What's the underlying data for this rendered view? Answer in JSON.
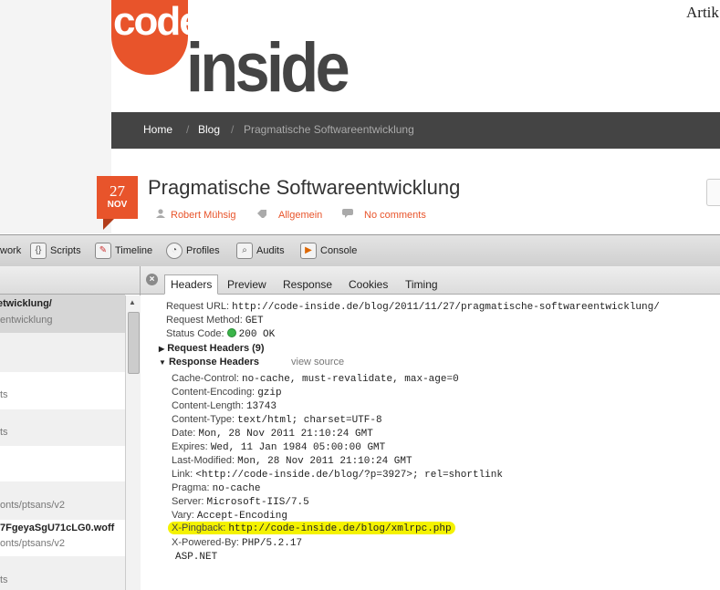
{
  "site": {
    "logo_code": "code",
    "logo_inside": "inside",
    "top_right_text": "Artik",
    "breadcrumb": [
      "Home",
      "Blog",
      "Pragmatische Softwareentwicklung"
    ],
    "date_day": "27",
    "date_month": "NOV",
    "post_title": "Pragmatische Softwareentwicklung",
    "author": "Robert Mühsig",
    "category": "Allgemein",
    "comments": "No comments",
    "accent_color": "#e8542b"
  },
  "devtools": {
    "toolbar": [
      {
        "label": "work",
        "icon": "network-icon"
      },
      {
        "label": "Scripts",
        "icon": "scripts-icon"
      },
      {
        "label": "Timeline",
        "icon": "timeline-icon"
      },
      {
        "label": "Profiles",
        "icon": "profiles-icon"
      },
      {
        "label": "Audits",
        "icon": "audits-icon"
      },
      {
        "label": "Console",
        "icon": "console-icon"
      }
    ],
    "resources": [
      {
        "name": "waretwicklung/",
        "path": "entwicklung"
      },
      {
        "name": "",
        "path": ""
      },
      {
        "name": "",
        "path": "ts"
      },
      {
        "name": "",
        "path": "ts"
      },
      {
        "name": "",
        "path": ""
      },
      {
        "name": "",
        "path": "onts/ptsans/v2"
      },
      {
        "name": "7FgeyaSgU71cLG0.woff",
        "path": "onts/ptsans/v2"
      },
      {
        "name": "",
        "path": "ts"
      }
    ],
    "tabs": [
      "Headers",
      "Preview",
      "Response",
      "Cookies",
      "Timing"
    ],
    "request": {
      "url_label": "Request URL:",
      "url": "http://code-inside.de/blog/2011/11/27/pragmatische-softwareentwicklung/",
      "method_label": "Request Method:",
      "method": "GET",
      "status_label": "Status Code:",
      "status": "200 OK"
    },
    "request_headers_label": "Request Headers (9)",
    "response_headers_label": "Response Headers",
    "view_source": "view source",
    "response_headers": [
      {
        "key": "Cache-Control:",
        "value": "no-cache, must-revalidate, max-age=0"
      },
      {
        "key": "Content-Encoding:",
        "value": "gzip"
      },
      {
        "key": "Content-Length:",
        "value": "13743"
      },
      {
        "key": "Content-Type:",
        "value": "text/html; charset=UTF-8"
      },
      {
        "key": "Date:",
        "value": "Mon, 28 Nov 2011 21:10:24 GMT"
      },
      {
        "key": "Expires:",
        "value": "Wed, 11 Jan 1984 05:00:00 GMT"
      },
      {
        "key": "Last-Modified:",
        "value": "Mon, 28 Nov 2011 21:10:24 GMT"
      },
      {
        "key": "Link:",
        "value": "<http://code-inside.de/blog/?p=3927>; rel=shortlink"
      },
      {
        "key": "Pragma:",
        "value": "no-cache"
      },
      {
        "key": "Server:",
        "value": "Microsoft-IIS/7.5"
      },
      {
        "key": "Vary:",
        "value": "Accept-Encoding"
      },
      {
        "key": "X-Pingback:",
        "value": "http://code-inside.de/blog/xmlrpc.php"
      },
      {
        "key": "X-Powered-By:",
        "value": "PHP/5.2.17"
      }
    ],
    "extra_value": "ASP.NET",
    "highlight_color": "#f4f200"
  }
}
